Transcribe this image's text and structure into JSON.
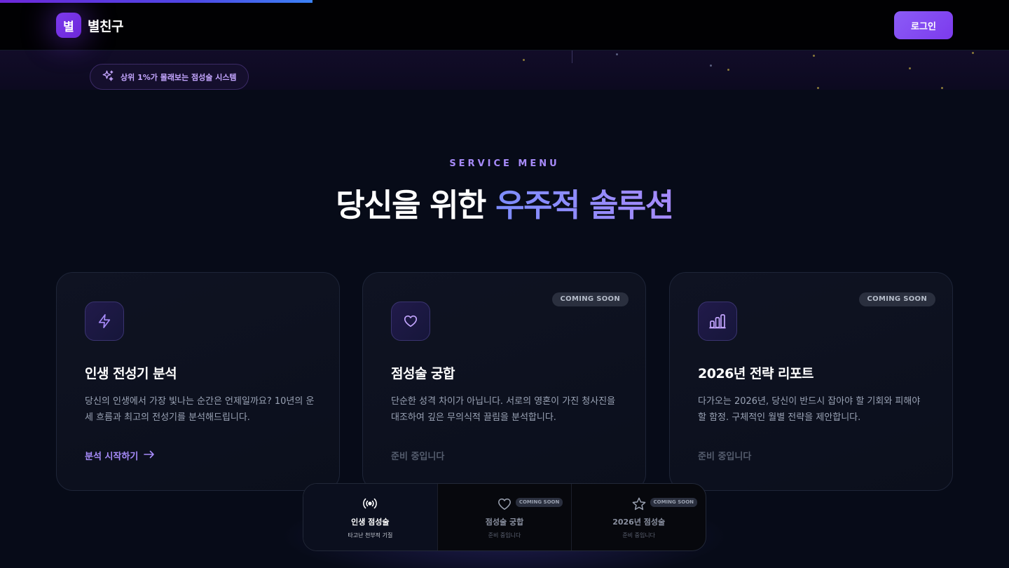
{
  "progress": {
    "fraction": 0.31
  },
  "header": {
    "logo_mark": "별",
    "logo_text": "별친구",
    "login_label": "로그인"
  },
  "hero": {
    "pill_text": "상위 1%가 몰래보는 점성술 시스템",
    "pill_icon": "sparkles-icon"
  },
  "section": {
    "eyebrow": "SERVICE MENU",
    "title_plain": "당신을 위한 ",
    "title_accent": "우주적 솔루션"
  },
  "cards": [
    {
      "icon": "bolt-icon",
      "title": "인생 전성기 분석",
      "desc": "당신의 인생에서 가장 빛나는 순간은 언제일까요? 10년의 운세 흐름과 최고의 전성기를 분석해드립니다.",
      "action": "분석 시작하기",
      "badge": ""
    },
    {
      "icon": "heart-icon",
      "title": "점성술 궁합",
      "desc": "단순한 성격 차이가 아닙니다. 서로의 영혼이 가진 청사진을 대조하여 깊은 무의식적 끌림을 분석합니다.",
      "action": "준비 중입니다",
      "badge": "COMING SOON"
    },
    {
      "icon": "bar-chart-icon",
      "title": "2026년 전략 리포트",
      "desc": "다가오는 2026년, 당신이 반드시 잡아야 할 기회와 피해야 할 함정. 구체적인 월별 전략을 제안합니다.",
      "action": "준비 중입니다",
      "badge": "COMING SOON"
    }
  ],
  "dock": [
    {
      "icon": "broadcast-icon",
      "label": "인생 점성술",
      "sub": "타고난 천부적 기질",
      "badge": ""
    },
    {
      "icon": "heart-icon",
      "label": "점성술 궁합",
      "sub": "준비 중입니다",
      "badge": "COMING SOON"
    },
    {
      "icon": "star-icon",
      "label": "2026년 점성술",
      "sub": "준비 중입니다",
      "badge": "COMING SOON"
    }
  ],
  "colors": {
    "background": "#070b18",
    "accent": "#8b5cf6",
    "accent_text": "#a78bfa"
  }
}
